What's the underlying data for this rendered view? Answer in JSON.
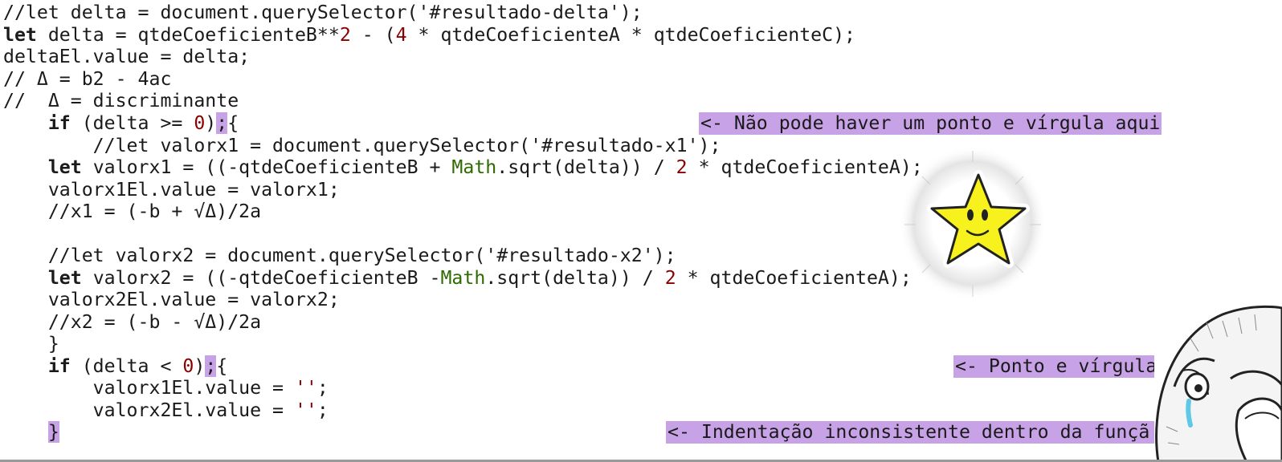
{
  "code": {
    "l1": "//let delta = document.querySelector('#resultado-delta');",
    "l2a": "let",
    "l2b": " delta = qtdeCoeficienteB**",
    "l2c": "2",
    "l2d": " - (",
    "l2e": "4",
    "l2f": " * qtdeCoeficienteA * qtdeCoeficienteC);",
    "l3": "deltaEl.value = delta;",
    "l4": "// Δ = b2 - 4ac",
    "l5": "//  Δ = discriminante",
    "l6a": "    ",
    "l6b": "if",
    "l6c": " (delta >= ",
    "l6d": "0",
    "l6e": ")",
    "l6f": ";",
    "l6g": "{",
    "l7": "        //let valorx1 = document.querySelector('#resultado-x1');",
    "l8a": "    ",
    "l8b": "let",
    "l8c": " valorx1 = ((-qtdeCoeficienteB + ",
    "l8d": "Math",
    "l8e": ".sqrt(delta)) / ",
    "l8f": "2",
    "l8g": " * qtdeCoeficienteA);",
    "l9": "    valorx1El.value = valorx1;",
    "l10": "    //x1 = (-b + √Δ)/2a",
    "l12": "    //let valorx2 = document.querySelector('#resultado-x2');",
    "l13a": "    ",
    "l13b": "let",
    "l13c": " valorx2 = ((-qtdeCoeficienteB -",
    "l13d": "Math",
    "l13e": ".sqrt(delta)) / ",
    "l13f": "2",
    "l13g": " * qtdeCoeficienteA);",
    "l14": "    valorx2El.value = valorx2;",
    "l15": "    //x2 = (-b - √Δ)/2a",
    "l16": "    }",
    "l17a": "    ",
    "l17b": "if",
    "l17c": " (delta < ",
    "l17d": "0",
    "l17e": ")",
    "l17f": ";",
    "l17g": "{",
    "l18a": "        valorx1El.value = ",
    "l18b": "''",
    "l18c": ";",
    "l19a": "        valorx2El.value = ",
    "l19b": "''",
    "l19c": ";",
    "l20a": "    ",
    "l20b": "}"
  },
  "annotations": {
    "semicolon_if": "<- Não pode haver um ponto e vírgula aqui",
    "semicolon_if2": "<- Ponto e vírgula",
    "indent": "<- Indentação inconsistente dentro da funçã"
  },
  "stickers": {
    "star": "smiling-star-icon",
    "meme": "crying-face-icon"
  },
  "colors": {
    "highlight": "#c8a2e6",
    "number": "#8b0000",
    "class": "#2e6b00",
    "text": "#1a1a1a"
  }
}
